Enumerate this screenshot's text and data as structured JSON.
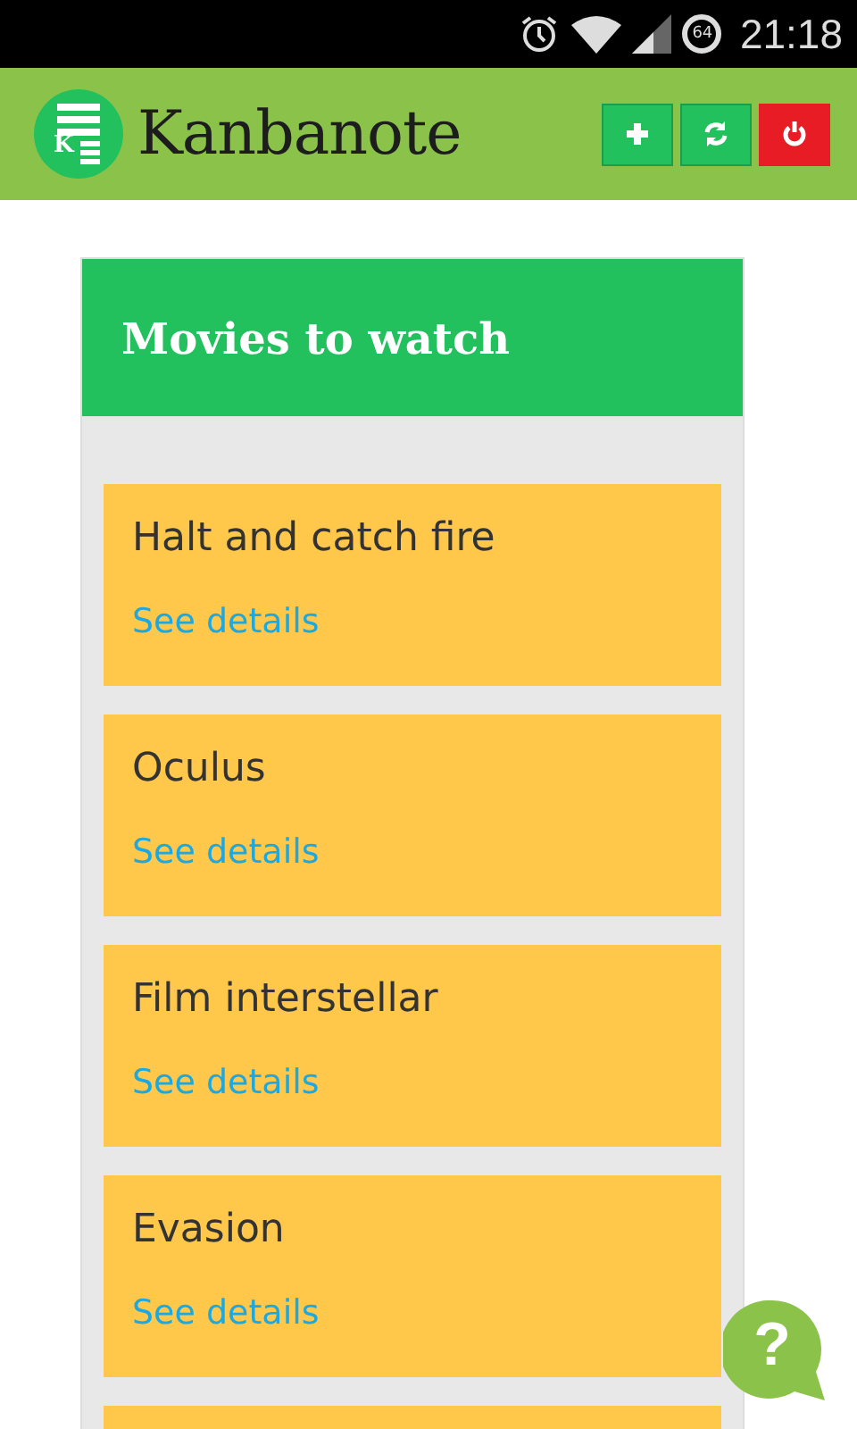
{
  "status_bar": {
    "battery": "64",
    "time": "21:18"
  },
  "app_bar": {
    "logo_letter": "K",
    "title": "Kanbanote",
    "buttons": [
      {
        "kind": "add"
      },
      {
        "kind": "refresh"
      },
      {
        "kind": "power"
      }
    ]
  },
  "column": {
    "title": "Movies to watch",
    "cards": [
      {
        "title": "Halt and catch fire",
        "link": "See details"
      },
      {
        "title": "Oculus",
        "link": "See details"
      },
      {
        "title": "Film interstellar",
        "link": "See details"
      },
      {
        "title": "Evasion",
        "link": "See details"
      }
    ]
  },
  "help_button": {
    "label": "?"
  }
}
